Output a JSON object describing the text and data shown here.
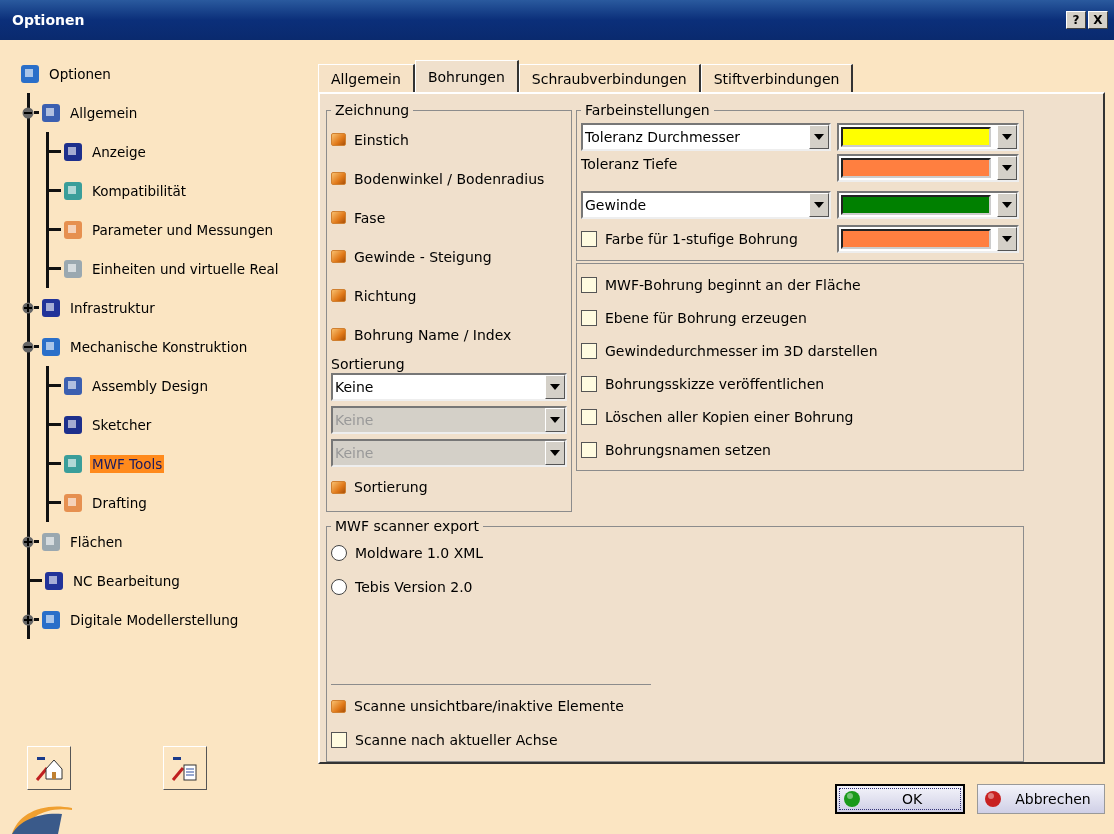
{
  "window": {
    "title": "Optionen",
    "buttons": [
      "?",
      "X"
    ]
  },
  "tree": [
    {
      "label": "Optionen",
      "selected": false,
      "children": [
        {
          "label": "Allgemein",
          "selected": false,
          "expanded": true,
          "children": [
            {
              "label": "Anzeige",
              "selected": false
            },
            {
              "label": "Kompatibilität",
              "selected": false
            },
            {
              "label": "Parameter und Messungen",
              "selected": false
            },
            {
              "label": "Einheiten und virtuelle Real",
              "selected": false
            }
          ]
        },
        {
          "label": "Infrastruktur",
          "selected": false,
          "expanded": false
        },
        {
          "label": "Mechanische Konstruktion",
          "selected": false,
          "expanded": true,
          "children": [
            {
              "label": "Assembly Design",
              "selected": false
            },
            {
              "label": "Sketcher",
              "selected": false
            },
            {
              "label": "MWF Tools",
              "selected": true
            },
            {
              "label": "Drafting",
              "selected": false
            }
          ]
        },
        {
          "label": "Flächen",
          "selected": false,
          "expanded": false
        },
        {
          "label": "NC Bearbeitung",
          "selected": false
        },
        {
          "label": "Digitale Modellerstellung",
          "selected": false,
          "expanded": false
        }
      ]
    }
  ],
  "tabs": [
    {
      "label": "Allgemein",
      "selected": false
    },
    {
      "label": "Bohrungen",
      "selected": true
    },
    {
      "label": "Schraubverbindungen",
      "selected": false
    },
    {
      "label": "Stiftverbindungen",
      "selected": false
    }
  ],
  "drawing": {
    "title": "Zeichnung",
    "options": [
      {
        "label": "Einstich",
        "checked": true
      },
      {
        "label": "Bodenwinkel / Bodenradius",
        "checked": true
      },
      {
        "label": "Fase",
        "checked": true
      },
      {
        "label": "Gewinde - Steigung",
        "checked": true
      },
      {
        "label": "Richtung",
        "checked": true
      },
      {
        "label": "Bohrung Name / Index",
        "checked": true
      }
    ],
    "sort_label": "Sortierung",
    "sort_selects": [
      {
        "value": "Keine",
        "disabled": false
      },
      {
        "value": "Keine",
        "disabled": true
      },
      {
        "value": "Keine",
        "disabled": true
      }
    ],
    "sort_option": {
      "label": "Sortierung",
      "checked": true
    }
  },
  "color_settings": {
    "title": "Farbeinstellungen",
    "rows": [
      {
        "kind": "select",
        "text": "Toleranz Durchmesser",
        "color": "#ffff00"
      },
      {
        "kind": "label",
        "text": "Toleranz Tiefe",
        "color": "#ff7f40"
      },
      {
        "kind": "select",
        "text": "Gewinde",
        "color": "#008000"
      },
      {
        "kind": "checkbox",
        "text": "Farbe für 1-stufige Bohrung",
        "checked": false,
        "color": "#ff7f40"
      }
    ]
  },
  "hole_options": [
    {
      "label": "MWF-Bohrung beginnt an der Fläche",
      "checked": false
    },
    {
      "label": "Ebene für Bohrung erzeugen",
      "checked": false
    },
    {
      "label": "Gewindedurchmesser im 3D darstellen",
      "checked": false
    },
    {
      "label": "Bohrungsskizze veröffentlichen",
      "checked": false
    },
    {
      "label": "Löschen aller Kopien einer Bohrung",
      "checked": false
    },
    {
      "label": "Bohrungsnamen setzen",
      "checked": false
    }
  ],
  "scanner": {
    "title": "MWF scanner export",
    "formats": [
      {
        "label": "Moldware 1.0 XML",
        "selected": false
      },
      {
        "label": "Tebis Version 2.0",
        "selected": false
      }
    ],
    "options": [
      {
        "label": "Scanne unsichtbare/inaktive Elemente",
        "checked": true
      },
      {
        "label": "Scanne nach aktueller Achse",
        "checked": false
      }
    ]
  },
  "footer_buttons": [
    {
      "label": "OK",
      "kind": "ok",
      "focused": true
    },
    {
      "label": "Abbrechen",
      "kind": "cancel",
      "focused": false
    }
  ]
}
